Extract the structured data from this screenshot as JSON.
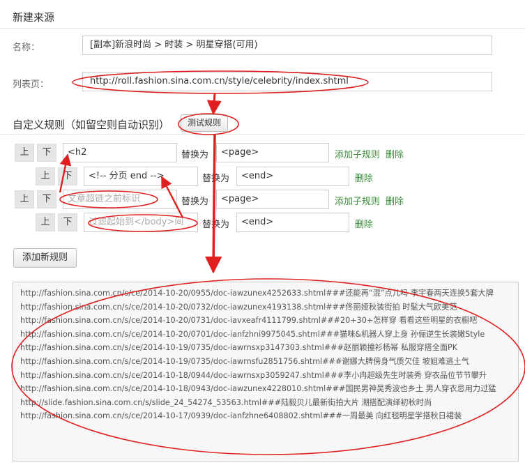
{
  "source": {
    "title": "新建来源",
    "name_label": "名称：",
    "name_value": "[副本]新浪时尚 > 时装 > 明星穿搭(可用)",
    "list_label": "列表页：",
    "list_value": "http://roll.fashion.sina.com.cn/style/celebrity/index.shtml"
  },
  "rules": {
    "title": "自定义规则（如留空则自动识别）",
    "test_button": "测试规则",
    "up_label": "上",
    "down_label": "下",
    "replace_label": "替换为",
    "add_child_label": "添加子规则",
    "delete_label": "删除",
    "add_rule_button": "添加新规则",
    "rows": [
      {
        "pattern": "<h2",
        "replacement": "<page>"
      },
      {
        "pattern": "<!-- 分页 end -->",
        "replacement": "<end>"
      },
      {
        "pattern": "",
        "placeholder": "文章超链之前标识",
        "replacement": "<page>"
      },
      {
        "pattern": "",
        "placeholder": "过滤起始到</body>间",
        "replacement": "<end>"
      }
    ]
  },
  "results": [
    "http://fashion.sina.com.cn/s/ce/2014-10-20/0955/doc-iawzunex4252633.shtml###还能再“混”点儿吗 李宇春两天连换5套大牌",
    "http://fashion.sina.com.cn/s/ce/2014-10-20/0732/doc-iawzunex4193138.shtml###佟丽娅秋装街拍 时髦大气欧美范",
    "http://fashion.sina.com.cn/s/ce/2014-10-20/0731/doc-iavxeafr4111799.shtml###20+30+怎样穿 看看这些明星的衣橱吧",
    "http://fashion.sina.com.cn/s/ce/2014-10-20/0701/doc-ianfzhni9975045.shtml###猫咪&机器人穿上身 孙俪逆生长装嫩Style",
    "http://fashion.sina.com.cn/s/ce/2014-10-19/0735/doc-iawrnsxp3147303.shtml###赵丽颖撞衫杨幂 私服穿搭全面PK",
    "http://fashion.sina.com.cn/s/ce/2014-10-19/0735/doc-iawrnsfu2851756.shtml###谢娜大牌傍身气质欠佳 坡姐难逃土气",
    "http://fashion.sina.com.cn/s/ce/2014-10-18/0944/doc-iawrnsxp3059247.shtml###李小冉超级先生时装秀 穿衣品位节节攀升",
    "http://fashion.sina.com.cn/s/ce/2014-10-18/0943/doc-iawzunex4228010.shtml###国民男神吴秀波也乡土 男人穿衣忌用力过猛",
    "http://slide.fashion.sina.com.cn/s/slide_24_54274_53563.html###陆毅贝儿最新街拍大片 潮搭配演绎初秋时尚",
    "http://fashion.sina.com.cn/s/ce/2014-10-17/0939/doc-ianfzhne6408802.shtml###一周最美 向红毯明星学搭秋日裙装"
  ],
  "colors": {
    "link": "#3a8c3a",
    "annotation": "#e02020"
  }
}
